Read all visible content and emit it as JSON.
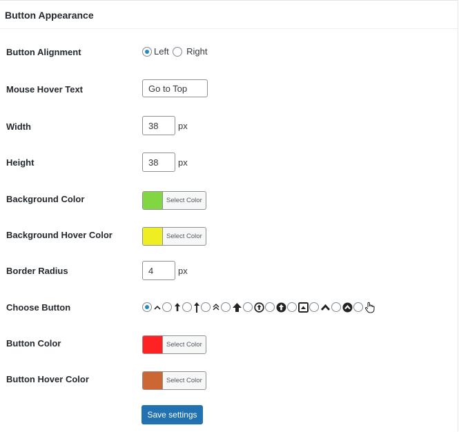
{
  "panel": {
    "title": "Button Appearance"
  },
  "alignment": {
    "label": "Button Alignment",
    "options": [
      "Left",
      "Right"
    ],
    "selected": "Left"
  },
  "hover_text": {
    "label": "Mouse Hover Text",
    "value": "Go to Top"
  },
  "width": {
    "label": "Width",
    "value": "38",
    "unit": "px"
  },
  "height": {
    "label": "Height",
    "value": "38",
    "unit": "px"
  },
  "bg_color": {
    "label": "Background Color",
    "button": "Select Color",
    "color": "#81d742"
  },
  "bg_hover_color": {
    "label": "Background Hover Color",
    "button": "Select Color",
    "color": "#eeee22"
  },
  "border_radius": {
    "label": "Border Radius",
    "value": "4",
    "unit": "px"
  },
  "choose_button": {
    "label": "Choose Button",
    "selected": 0,
    "icons": [
      "caret-up-icon",
      "arrow-up-icon",
      "long-arrow-up-icon",
      "double-chevron-up-icon",
      "bold-arrow-up-icon",
      "circle-arrow-up-icon",
      "filled-circle-arrow-up-icon",
      "square-caret-up-icon",
      "chevron-up-icon",
      "filled-circle-chevron-up-icon",
      "hand-pointer-up-icon"
    ]
  },
  "button_color": {
    "label": "Button Color",
    "button": "Select Color",
    "color": "#ff2222"
  },
  "button_hover_color": {
    "label": "Button Hover Color",
    "button": "Select Color",
    "color": "#cc6633"
  },
  "save": {
    "label": "Save settings"
  }
}
